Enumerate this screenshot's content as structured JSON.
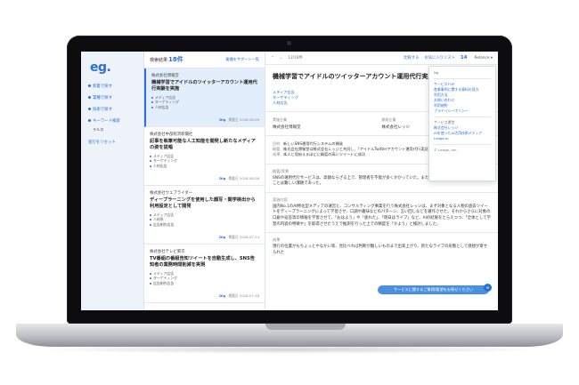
{
  "app": {
    "logo": "eg."
  },
  "sidebar": {
    "items": [
      {
        "label": "新着で探す"
      },
      {
        "label": "業種で探す"
      },
      {
        "label": "技術で探す"
      }
    ],
    "search_label": "キーワード検索",
    "search_sub": "ラルロ",
    "footer_link": "進行をリセット"
  },
  "list": {
    "count_label": "検索結果",
    "count": "18件",
    "sort_link": "業種をサポート一覧",
    "cards": [
      {
        "company": "株式会社博報堂",
        "title": "機械学習でアイドルのツイッターアカウント運用代行実験を実施",
        "tags": [
          "メディア広告",
          "ターゲティング",
          "人材広告"
        ],
        "brand": "Dig",
        "date": "掲載日 2018-08-09"
      },
      {
        "company": "株式会社中部経済新聞社",
        "title": "記事を執筆可能な人工知能を開発し新たなメディアの姿を提唱",
        "tags": [
          "メディア広告",
          "ターゲティング",
          "人材広告"
        ],
        "brand": "Dig",
        "date": "掲載日 2018-08-08"
      },
      {
        "company": "株式会社ウェブライダー",
        "title": "ディープラーニングを使用した顔写・関学検出から利用設定として開発",
        "tags": [
          "メディア広告",
          "人材系",
          "広告制作広告"
        ],
        "brand": "Dig",
        "date": "掲載日 2018-07-24"
      },
      {
        "company": "株式会社テレビ東京",
        "title": "TV番組の番組告知ツイートを自動生成し、SNS告知者の業務時間削減を実現",
        "tags": [
          "メディア広告",
          "ターゲティング",
          "広告制作広告"
        ],
        "brand": "Dig",
        "date": "掲載日 2018-07-18"
      }
    ]
  },
  "topbar": {
    "page_info": "12/18件",
    "fav_link": "お気に入りリスト",
    "fav_count": "14",
    "user_menu": "Relance ▾",
    "compare_link": "比較する"
  },
  "detail": {
    "title": "機械学習でアイドルのツイッターアカウント運用代行実験を実",
    "tags": [
      "メディア広告",
      "ターゲティング",
      "人材広告"
    ],
    "info": [
      {
        "label": "実施企業",
        "value": "株式会社博報堂"
      },
      {
        "label": "開発企業",
        "value": "株式会社レッジ"
      }
    ],
    "summary": [
      {
        "k": "目的",
        "v": "新しいSNS運用代行システムの開発"
      },
      {
        "k": "概要",
        "v": "株式会社博報堂は株式会社レッジと共同し、「アイドルTwitterアカウント運用代行実証実験」を実施された"
      },
      {
        "k": "成果",
        "v": "本人と見紛えるほどに精度の高いツイートに成功"
      }
    ],
    "sections": [
      {
        "heading": "概要/背景",
        "text": "SNSの運用代行サービスは、高額ならざる上で、管理者を不能が多くかかっていた。また、「その人らしさ」をAIで表現することは難しい課題であった。"
      },
      {
        "heading": "実施内容",
        "text": "国内No.1のAI特化型メディアの運営と、コンサルティング事業を行う株式会社レッジは、まず対象となる人物の過去ツイートをディープラーニングによって学習させ、口調や趣味などのパターン、言い回しなどを著作させた。それからさらに対象の口癖や返答等の情報を学習させて、「おはよう」や「疲れた」、「明日はライブ」など、AIの結果をとらえつつ、「全体として学習の内容の特徴や」を取得させたうえで推測を行った上での精度を「かよう」と検討しました。"
      },
      {
        "heading": "成果",
        "text": "現行の位置がもちょっとやなかい等、見比べれば判断が難しいものまで出来上がり、新たなライブの形態として感想が寄せられた"
      }
    ]
  },
  "dropdown": {
    "header": "Ng",
    "group1": [
      "サービスTOP",
      "産業事例に関する資料の見方",
      "利用方法",
      "お問い合わせ",
      "利用規約",
      "プライバシーポリシー"
    ],
    "group2_header": "サービス運営",
    "group2": [
      "株式会社レッジ",
      "AIを使ったAI活用技術メディア",
      "Ledge.ai"
    ],
    "footer": "© Ledge, Inc."
  },
  "floating": {
    "label": "サービスに関するご質問/要望をお寄せください"
  },
  "colors": {
    "accent": "#2b6fd6",
    "sidebar_bg": "#eef3fa",
    "active_card_bg": "#e3eefc"
  }
}
